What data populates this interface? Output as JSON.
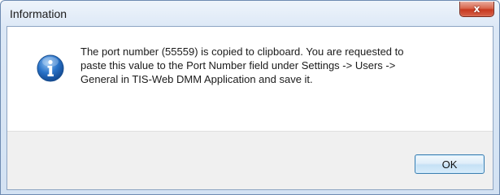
{
  "dialog": {
    "title": "Information",
    "close_glyph": "x",
    "icon": "information-icon",
    "message": "The port number (55559) is copied to clipboard. You are requested to\npaste this value to the Port Number field under Settings -> Users ->\nGeneral in TIS-Web DMM Application and save it.",
    "ok_label": "OK"
  },
  "colors": {
    "icon_blue": "#1f63b8",
    "close_red": "#c7391f",
    "button_border": "#3c7fb1"
  }
}
